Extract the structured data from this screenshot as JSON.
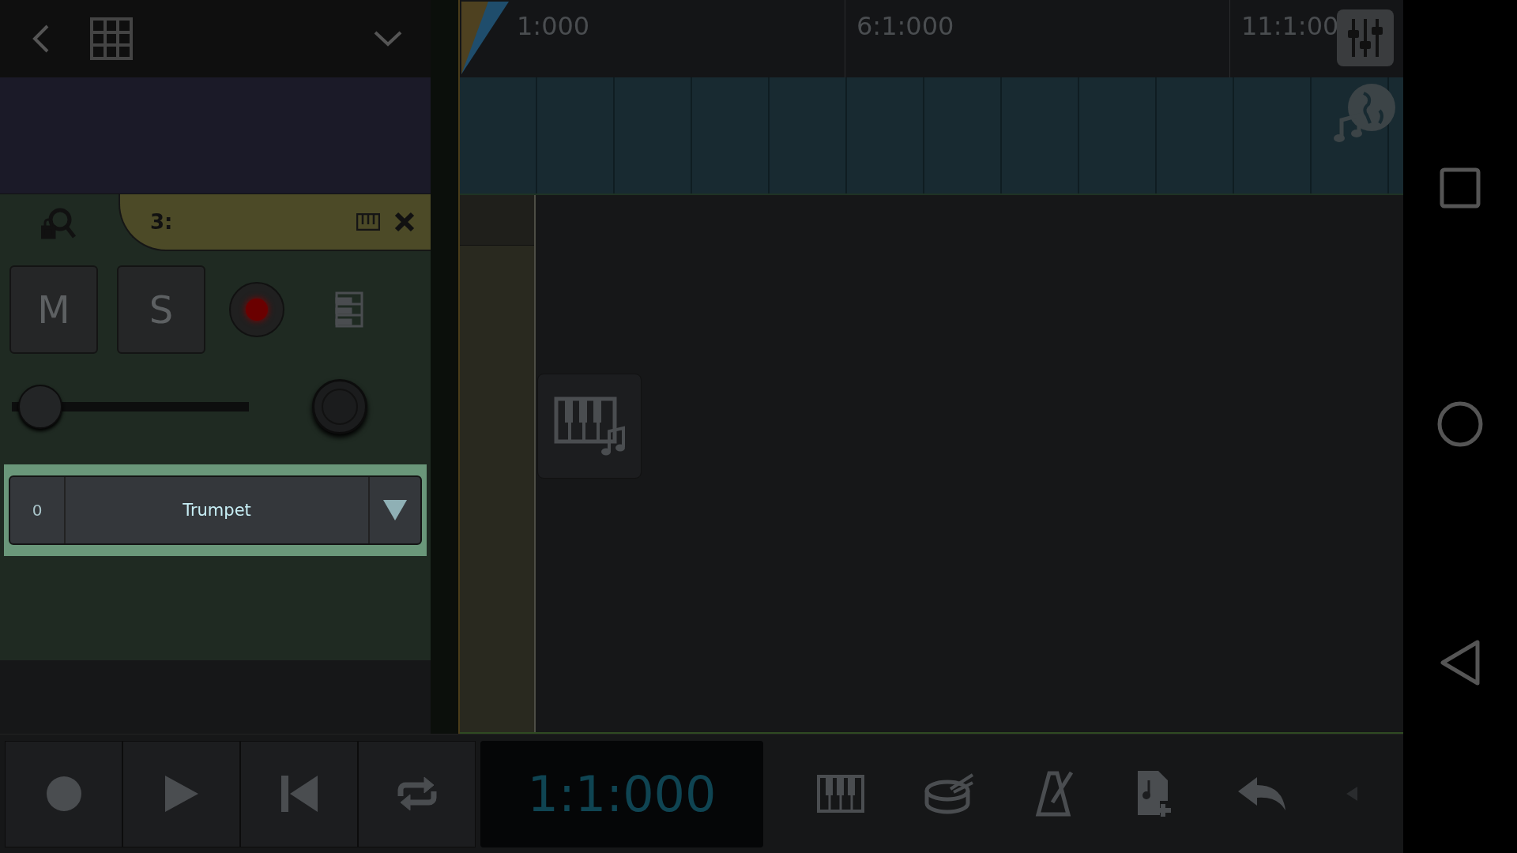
{
  "ruler": {
    "markers": [
      "1:000",
      "6:1:000",
      "11:1:00"
    ]
  },
  "track": {
    "number": "3:",
    "mute": {
      "label": "M",
      "on": false
    },
    "solo": {
      "label": "S",
      "on": false
    },
    "record_armed": true,
    "volume": {
      "level": 0.03
    },
    "instrument": {
      "channel": "0",
      "name": "Trumpet",
      "highlighted": true
    }
  },
  "transport": {
    "time": "1:1:000"
  }
}
